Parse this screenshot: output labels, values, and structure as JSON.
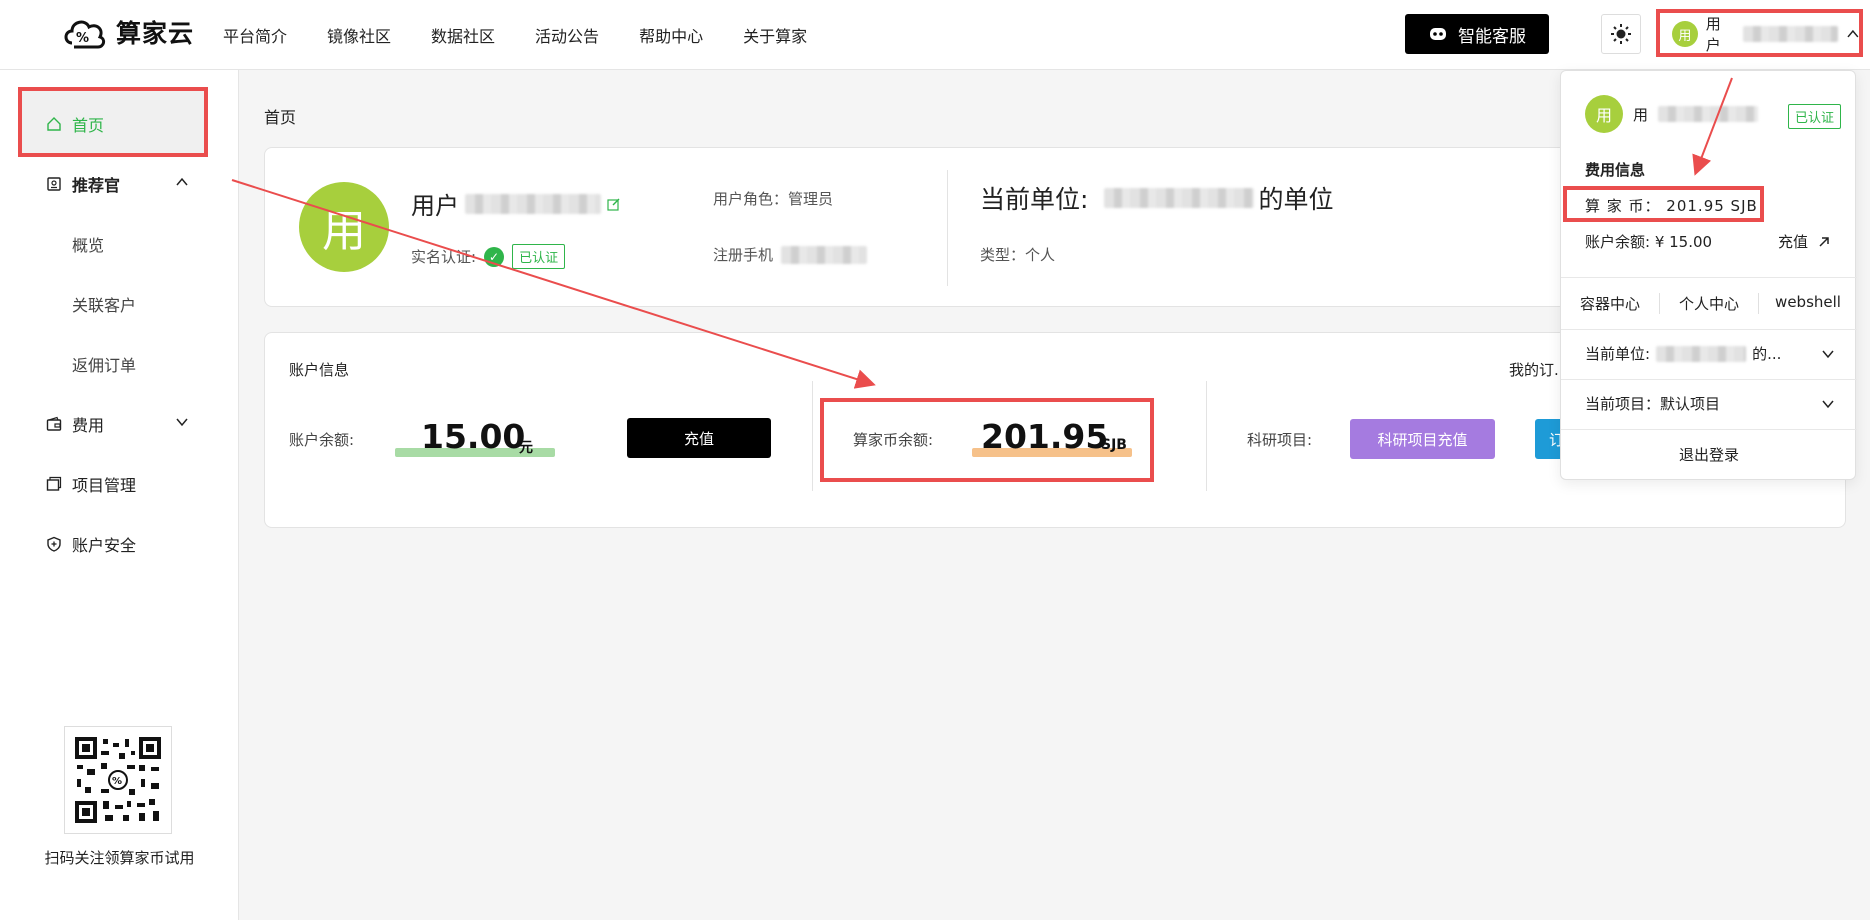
{
  "brand": {
    "name": "算家云"
  },
  "nav": [
    "平台简介",
    "镜像社区",
    "数据社区",
    "活动公告",
    "帮助中心",
    "关于算家"
  ],
  "header": {
    "service_label": "智能客服",
    "user_avatar": "用",
    "user_name": "用户"
  },
  "sidebar": {
    "home": "首页",
    "recommender": "推荐官",
    "recommender_items": [
      "概览",
      "关联客户",
      "返佣订单"
    ],
    "fees": "费用",
    "projects": "项目管理",
    "security": "账户安全",
    "qr_caption": "扫码关注领算家币试用"
  },
  "breadcrumb": "首页",
  "profile": {
    "avatar": "用",
    "name": "用户",
    "realname_label": "实名认证:",
    "verified_tag": "已认证",
    "role": "用户角色：管理员",
    "phone_label": "注册手机",
    "unit_label": "当前单位:",
    "unit_suffix": "的单位",
    "type": "类型：个人"
  },
  "account": {
    "title": "账户信息",
    "balance_label": "账户余额:",
    "balance_value": "15.00",
    "balance_unit": "元",
    "recharge": "充值",
    "coin_label": "算家币余额:",
    "coin_value": "201.95",
    "coin_unit": "SJB",
    "research_label": "科研项目:",
    "research_btn": "科研项目充值",
    "partial_btn": "订",
    "my_orders": "我的订."
  },
  "dropdown": {
    "avatar": "用",
    "name": "用",
    "tag": "已认证",
    "section": "费用信息",
    "coin": "算 家 币：  201.95 SJB",
    "balance": "账户余额:  ¥  15.00",
    "recharge": "充值",
    "links": [
      "容器中心",
      "个人中心",
      "webshell"
    ],
    "current_unit": "当前单位:",
    "unit_suffix": "的...",
    "current_project": "当前项目：默认项目",
    "logout": "退出登录"
  },
  "colors": {
    "accent": "#2fb54a",
    "avatar": "#a7cf3d",
    "annotation": "#ea4d4d",
    "purple": "#a57be0"
  }
}
